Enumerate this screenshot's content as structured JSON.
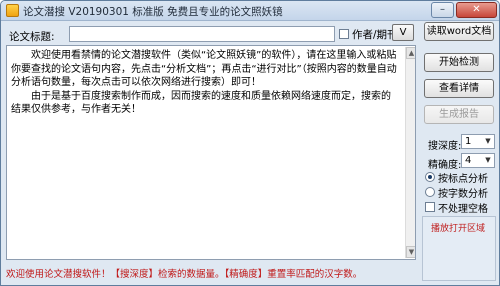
{
  "window": {
    "title": "论文潜搜 V20190301 标准版 免费且专业的论文照妖镜",
    "minimize_glyph": "–",
    "close_glyph": "✕"
  },
  "form": {
    "title_label": "论文标题:",
    "title_value": "",
    "dedup_checkbox_label": "作者/期刊",
    "dedup_checked": false,
    "v_button_label": "V"
  },
  "main_text": {
    "paragraphs": [
      "欢迎使用看禁情的论文潜搜软件（类似“论文照妖镜”的软件），请在这里输入或粘贴你要查找的论文语句内容，先点击“分析文档”；再点击“进行对比”（按照内容的数量自动分析语句数量，每次点击可以依次网络进行搜索）即可！",
      "由于是基于百度搜索制作而成，因而搜索的速度和质量依赖网络速度而定，搜索的结果仅供参考，与作者无关！"
    ]
  },
  "sidebar": {
    "read_button": "读取word文档",
    "check_button": "开始检测",
    "view_button": "查看详情",
    "report_button": "生成报告",
    "report_enabled": false,
    "search_depth_label": "搜深度:",
    "search_depth_value": "1",
    "precision_label": "精确度:",
    "precision_value": "4",
    "radio_punct_label": "按标点分析",
    "radio_chars_label": "按字数分析",
    "radio_selected": "punct",
    "no_space_label": "不处理空格",
    "no_space_checked": false,
    "promo_label": "播放打开区域"
  },
  "status_bar": {
    "text": "欢迎使用论文潜搜软件！【搜深度】检索的数据量。【精确度】重置率匹配的汉字数。"
  },
  "colors": {
    "window_bg": "#dfe8f2",
    "status_text": "#c01818",
    "promo_text": "#c02020"
  }
}
